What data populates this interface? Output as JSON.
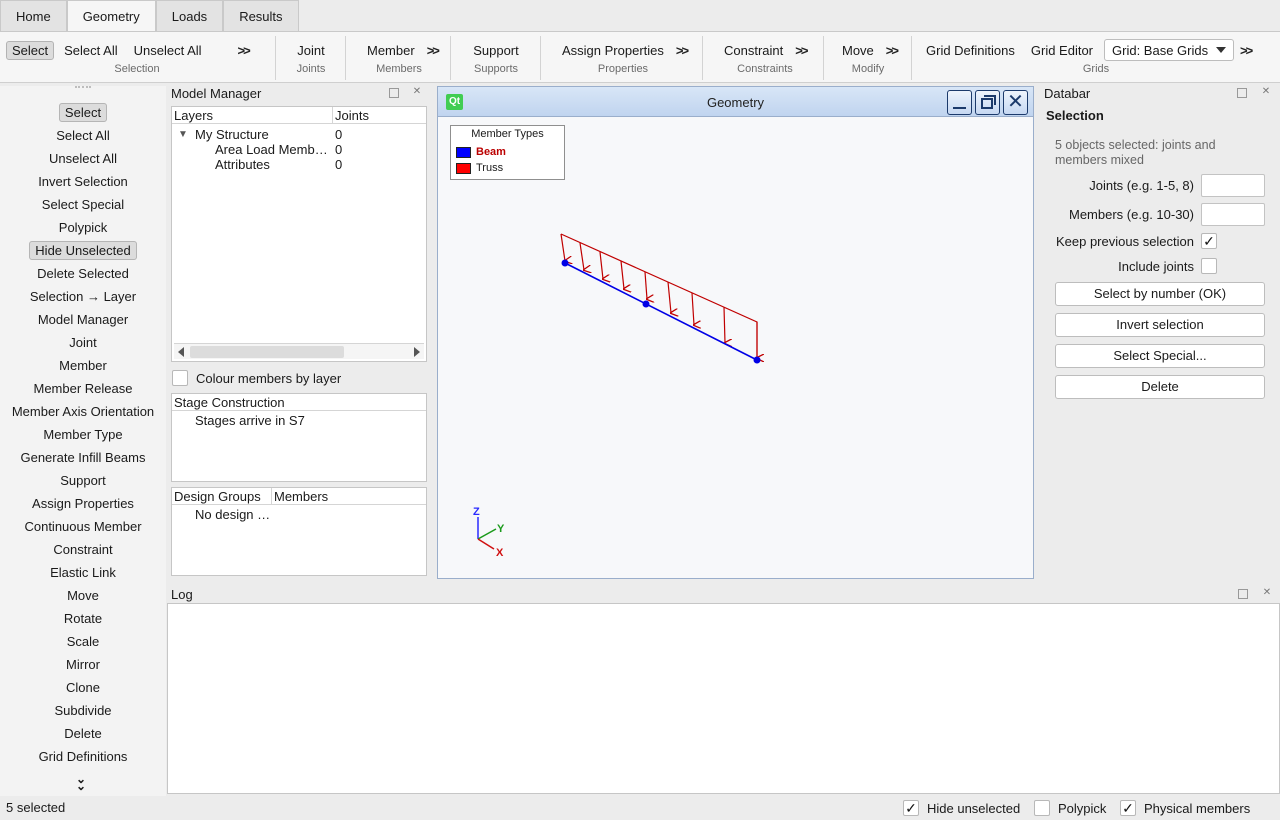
{
  "tabs": [
    "Home",
    "Geometry",
    "Loads",
    "Results"
  ],
  "active_tab": "Geometry",
  "ribbon": {
    "selection": {
      "select": "Select",
      "select_all": "Select All",
      "unselect_all": "Unselect All",
      "group": "Selection"
    },
    "joints": {
      "joint": "Joint",
      "group": "Joints"
    },
    "members": {
      "member": "Member",
      "group": "Members"
    },
    "supports": {
      "support": "Support",
      "group": "Supports"
    },
    "properties": {
      "assign": "Assign Properties",
      "group": "Properties"
    },
    "constraints": {
      "constraint": "Constraint",
      "group": "Constraints"
    },
    "modify": {
      "move": "Move",
      "group": "Modify"
    },
    "grids": {
      "grid_definitions": "Grid Definitions",
      "grid_editor": "Grid Editor",
      "grid_combo": "Grid: Base Grids",
      "group": "Grids"
    }
  },
  "left_toolbar": {
    "items": [
      {
        "label": "Select",
        "pressed": true
      },
      {
        "label": "Select All"
      },
      {
        "label": "Unselect All"
      },
      {
        "label": "Invert Selection"
      },
      {
        "label": "Select Special"
      },
      {
        "label": "Polypick"
      },
      {
        "label": "Hide Unselected",
        "pressed": true
      },
      {
        "label": "Delete Selected"
      },
      {
        "label": "Selection → Layer"
      },
      {
        "label": "Model Manager"
      },
      {
        "label": "Joint"
      },
      {
        "label": "Member"
      },
      {
        "label": "Member Release"
      },
      {
        "label": "Member Axis Orientation"
      },
      {
        "label": "Member Type"
      },
      {
        "label": "Generate Infill Beams"
      },
      {
        "label": "Support"
      },
      {
        "label": "Assign Properties"
      },
      {
        "label": "Continuous Member"
      },
      {
        "label": "Constraint"
      },
      {
        "label": "Elastic Link"
      },
      {
        "label": "Move"
      },
      {
        "label": "Rotate"
      },
      {
        "label": "Scale"
      },
      {
        "label": "Mirror"
      },
      {
        "label": "Clone"
      },
      {
        "label": "Subdivide"
      },
      {
        "label": "Delete"
      },
      {
        "label": "Grid Definitions"
      }
    ]
  },
  "model_manager": {
    "title": "Model Manager",
    "headers": [
      "Layers",
      "Joints"
    ],
    "rows": [
      {
        "name": "My Structure",
        "joints": "0"
      },
      {
        "name": "Area Load Memb…",
        "joints": "0"
      },
      {
        "name": "Attributes",
        "joints": "0"
      }
    ],
    "colour_by_layer": "Colour members by layer",
    "stage_header": "Stage Construction",
    "stage_row": "Stages arrive in S7",
    "design_headers": [
      "Design Groups",
      "Members"
    ],
    "design_row": "No design …"
  },
  "geometry": {
    "title": "Geometry",
    "logo": "Qt",
    "legend_title": "Member Types",
    "legend": [
      {
        "label": "Beam",
        "color": "#0000ff"
      },
      {
        "label": "Truss",
        "color": "#ff0000"
      }
    ],
    "axes": {
      "z": "Z",
      "y": "Y",
      "x": "X"
    }
  },
  "databar": {
    "title": "Databar",
    "section": "Selection",
    "info": "5 objects selected: joints and members mixed",
    "joints_label": "Joints (e.g. 1-5, 8)",
    "members_label": "Members (e.g. 10-30)",
    "keep_label": "Keep previous selection",
    "keep_checked": true,
    "include_label": "Include joints",
    "include_checked": false,
    "btn_select_number": "Select by number (OK)",
    "btn_invert": "Invert selection",
    "btn_special": "Select Special...",
    "btn_delete": "Delete"
  },
  "log": {
    "title": "Log"
  },
  "status": {
    "selected": "5 selected",
    "hide_unselected": "Hide unselected",
    "polypick": "Polypick",
    "physical_members": "Physical members"
  }
}
